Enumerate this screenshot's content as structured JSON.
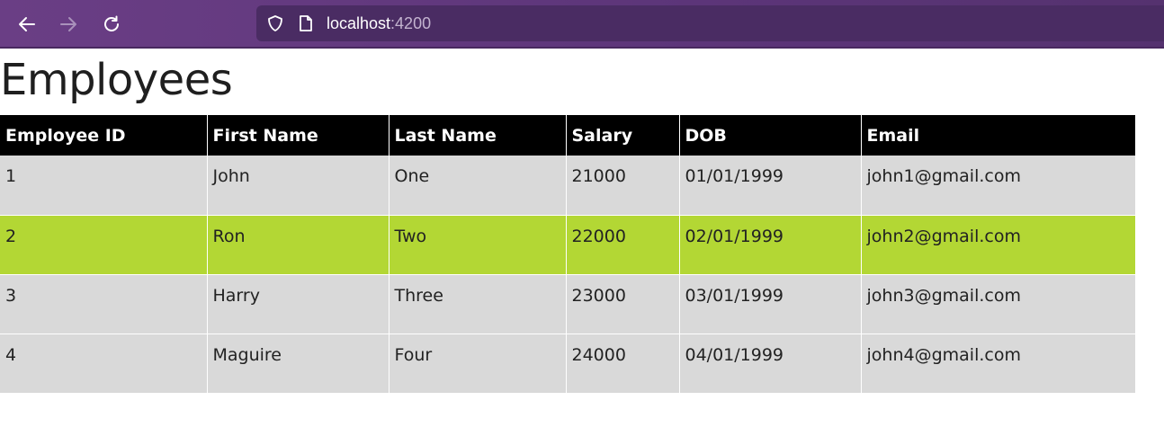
{
  "browser": {
    "url_host": "localhost",
    "url_port": ":4200",
    "icons": {
      "back": "arrow-left-icon",
      "forward": "arrow-right-icon",
      "reload": "reload-icon",
      "tracking": "shield-icon",
      "page": "page-icon"
    }
  },
  "page": {
    "title": "Employees"
  },
  "table": {
    "columns": [
      "Employee ID",
      "First Name",
      "Last Name",
      "Salary",
      "DOB",
      "Email"
    ],
    "rows": [
      [
        "1",
        "John",
        "One",
        "21000",
        "01/01/1999",
        "john1@gmail.com"
      ],
      [
        "2",
        "Ron",
        "Two",
        "22000",
        "02/01/1999",
        "john2@gmail.com"
      ],
      [
        "3",
        "Harry",
        "Three",
        "23000",
        "03/01/1999",
        "john3@gmail.com"
      ],
      [
        "4",
        "Maguire",
        "Four",
        "24000",
        "04/01/1999",
        "john4@gmail.com"
      ]
    ],
    "selected_row": 1
  },
  "colors": {
    "header_bg": "#000000",
    "row_bg": "#d9d9d9",
    "selected_row_bg": "#b3d734",
    "toolbar_bg": "#6a3e85"
  }
}
